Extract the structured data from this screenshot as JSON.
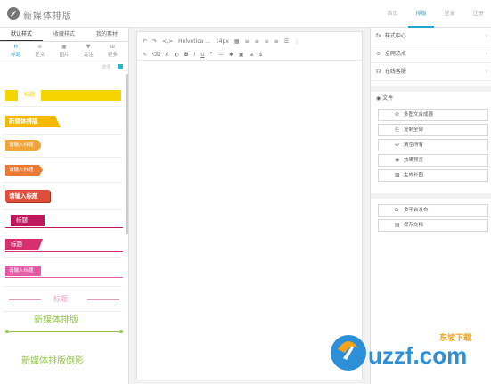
{
  "header": {
    "app_title": "新媒体排版",
    "nav": [
      "首页",
      "排版",
      "登录",
      "注册"
    ],
    "active_nav": 1
  },
  "left": {
    "tabs": [
      "默认样式",
      "收藏样式",
      "我的素材"
    ],
    "categories": [
      {
        "icon": "H",
        "label": "标题"
      },
      {
        "icon": "≡",
        "label": "正文"
      },
      {
        "icon": "▣",
        "label": "图片"
      },
      {
        "icon": "♥",
        "label": "关注"
      },
      {
        "icon": "⊞",
        "label": "更多"
      }
    ],
    "hint": "选项",
    "samples": [
      "标题",
      "新媒体排版",
      "请输入标题",
      "请输入标题",
      "请输入标题",
      "标题",
      "标题",
      "请输入标题",
      "标题",
      "新媒体排版",
      "新媒体排版倒影"
    ]
  },
  "editor": {
    "font": "Helvetica ...",
    "size": "14px"
  },
  "right": {
    "links": [
      {
        "icon": "fx",
        "label": "样式中心"
      },
      {
        "icon": "⊙",
        "label": "全网热点"
      },
      {
        "icon": "☊",
        "label": "在线客服"
      }
    ],
    "file_label": "文件",
    "file_buttons": [
      {
        "icon": "⊘",
        "label": "多图文合成器"
      },
      {
        "icon": "⎘",
        "label": "复制全部"
      },
      {
        "icon": "⊖",
        "label": "清空所有"
      },
      {
        "icon": "◉",
        "label": "效果预览"
      },
      {
        "icon": "▨",
        "label": "生成长图"
      }
    ],
    "publish_buttons": [
      {
        "icon": "⌂",
        "label": "多平台发布"
      },
      {
        "icon": "▤",
        "label": "保存文档"
      }
    ]
  },
  "watermark": {
    "brand": "uzzf.com",
    "cn": "东坡下载"
  },
  "colors": {
    "accent": "#29a3c9",
    "yellow": "#f5d500",
    "orange": "#f0a43a",
    "red": "#e04d3a",
    "magenta": "#d8306f",
    "green": "#8cc63f"
  }
}
